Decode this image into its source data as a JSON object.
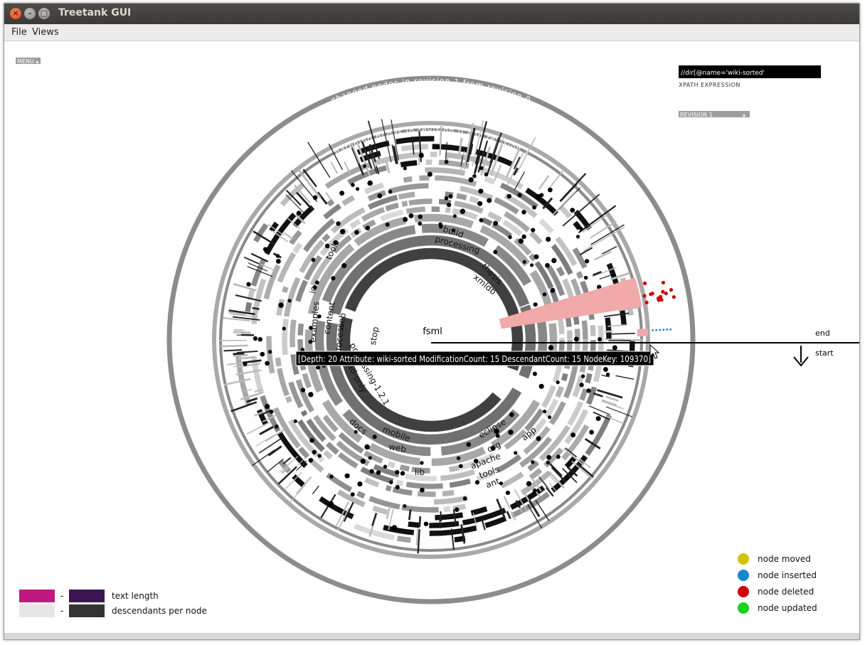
{
  "window": {
    "title": "Treetank GUI"
  },
  "menubar": {
    "file": "File",
    "views": "Views"
  },
  "controls": {
    "menu_label": "MENU",
    "xpath_value": "//dir[@name='wiki-sorted'",
    "xpath_label": "XPATH EXPRESSION",
    "revision_label": "REVISION 1"
  },
  "rings": {
    "outer_label": "changed nodes in revision 1 from revision 0",
    "inner_label": "matching nodes in revision 0 and revision 1",
    "center_label": "fsml"
  },
  "node_labels": [
    "build",
    "processing",
    "thesis",
    "xmldb",
    "tools",
    "io",
    "examples",
    "content",
    "web",
    "process",
    "stop",
    "processing-1.2.1",
    "read-only",
    "docs",
    "mobile",
    "web",
    "eclipse",
    "org",
    "apache",
    "tools",
    "ant",
    "app",
    "lib"
  ],
  "tooltip": {
    "text": "[Depth: 20 Attribute: wiki-sorted ModificationCount: 15 DescendantCount: 15 NodeKey: 109370]"
  },
  "time_marker": {
    "end": "end",
    "start": "start"
  },
  "legend_gradients": [
    {
      "label": "text length",
      "from_color": "#c0187e",
      "to_color": "#3c1650",
      "separator": "-"
    },
    {
      "label": "descendants per node",
      "from_color": "#e6e6e6",
      "to_color": "#333333",
      "separator": "-"
    }
  ],
  "legend_status": [
    {
      "label": "node moved",
      "color": "#d2c200"
    },
    {
      "label": "node inserted",
      "color": "#1388cf"
    },
    {
      "label": "node deleted",
      "color": "#d20000"
    },
    {
      "label": "node updated",
      "color": "#19d219"
    }
  ]
}
